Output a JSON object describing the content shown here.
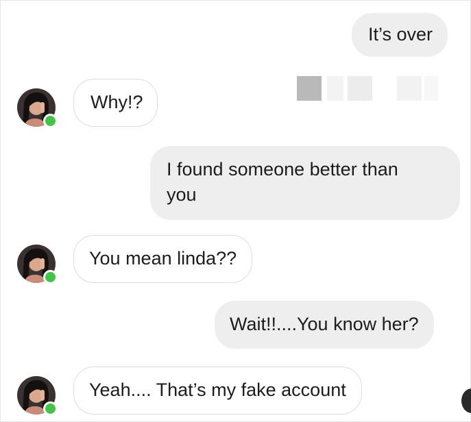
{
  "conversation": {
    "messages": [
      {
        "sender": "me",
        "text": "It’s over"
      },
      {
        "sender": "contact",
        "text": "Why!?"
      },
      {
        "sender": "me",
        "text_line1": "I found someone better than",
        "text_line2": "you"
      },
      {
        "sender": "contact",
        "text": "You mean linda??"
      },
      {
        "sender": "me",
        "text": "Wait!!....You know her?"
      },
      {
        "sender": "contact",
        "text": "Yeah.... That’s my fake account"
      }
    ]
  },
  "contact": {
    "avatar_icon": "contact-avatar-icon",
    "online_status": "online"
  },
  "colors": {
    "sent_bubble": "#eeeeee",
    "received_bubble_border": "#dcdcdc",
    "online_indicator": "#44c24a",
    "text": "#1c1c1c"
  }
}
